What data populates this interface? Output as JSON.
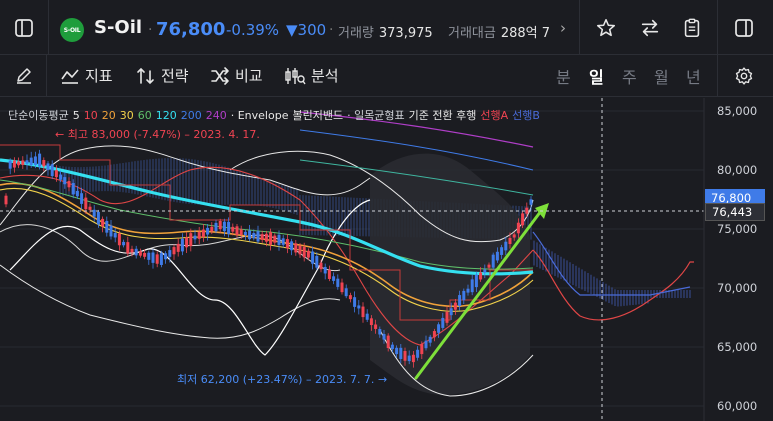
{
  "header": {
    "stock_name": "S-Oil",
    "logo_text": "S-OIL",
    "price": "76,800",
    "change_pct": "-0.39%",
    "change_abs": "▼300",
    "volume_label": "거래량",
    "volume_value": "373,975",
    "amount_label": "거래대금",
    "amount_value": "288억 7"
  },
  "toolbar": {
    "indicator_label": "지표",
    "strategy_label": "전략",
    "compare_label": "비교",
    "analysis_label": "분석",
    "periods": [
      "분",
      "일",
      "주",
      "월",
      "년"
    ],
    "active_period": "일"
  },
  "legend": {
    "ma_label": "단순이동평균",
    "ma_periods": [
      "5",
      "10",
      "20",
      "30",
      "60",
      "120",
      "200",
      "240"
    ],
    "envelope": "· Envelope",
    "bollinger": "볼린저밴드",
    "ichimoku": "· 일목균형표",
    "ichimoku_lines": "기준 전환 후행",
    "span_a": "선행A",
    "span_b": "선행B"
  },
  "annotations": {
    "high": "최고 83,000 (-7.47%) – 2023. 4. 17.",
    "low": "최저 62,200 (+23.47%) – 2023. 7. 7."
  },
  "axis": {
    "labels": [
      "85,000",
      "80,000",
      "75,000",
      "70,000",
      "65,000",
      "60,000"
    ],
    "current_price_tag": "76,800",
    "crosshair_tag": "76,443"
  },
  "colors": {
    "background": "#1b1c21",
    "up": "#f04452",
    "down": "#3f7be8",
    "accent_blue": "#4a8cf7",
    "trend_line": "#7ee03a",
    "ma_cyan": "#35e0f0"
  },
  "chart_data": {
    "type": "line",
    "title": "",
    "ylim": [
      59500,
      86000
    ],
    "y_ticks": [
      85000,
      80000,
      75000,
      70000,
      65000,
      60000
    ],
    "last_price": 76800,
    "crosshair_price": 76443,
    "period_high": 83000,
    "period_low": 62200
  }
}
